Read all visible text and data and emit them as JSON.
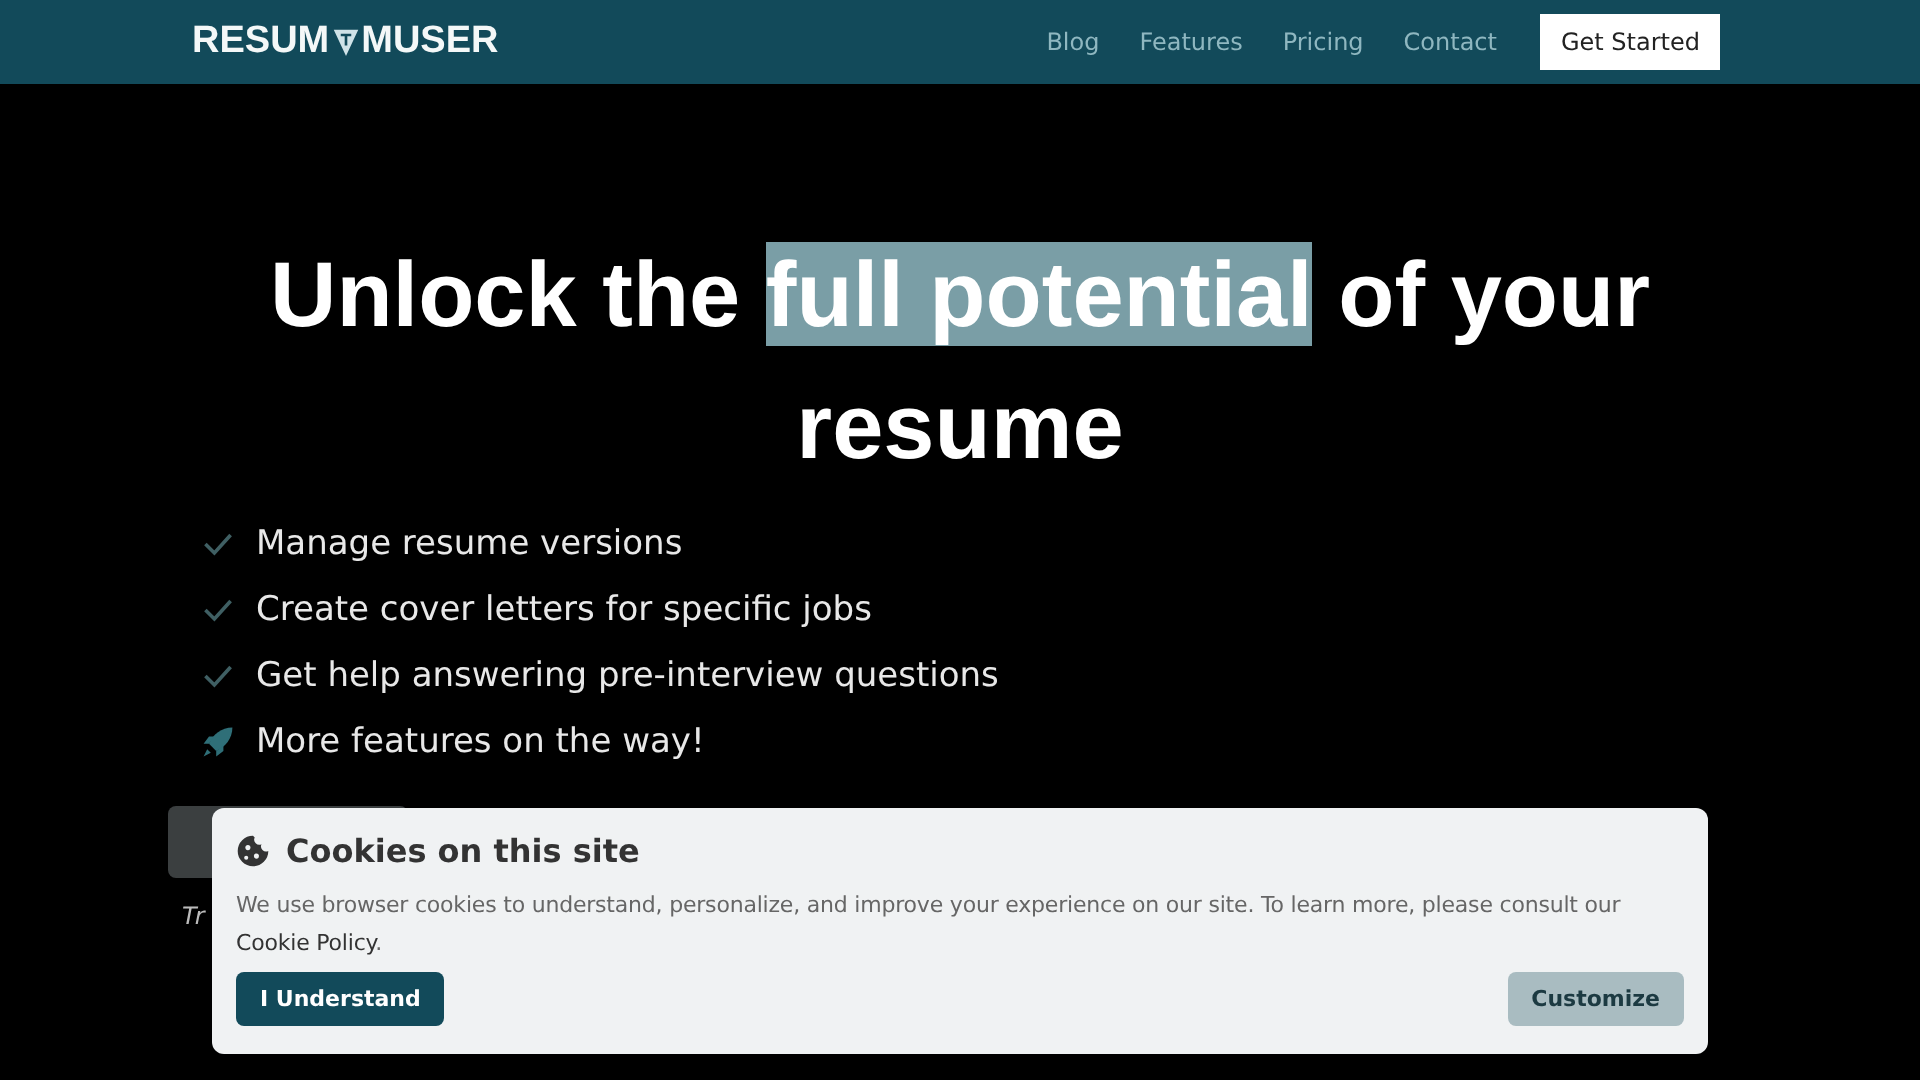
{
  "nav": {
    "logo": {
      "left": "RESUM",
      "right": "MUSER"
    },
    "links": [
      "Blog",
      "Features",
      "Pricing",
      "Contact"
    ],
    "cta": "Get Started"
  },
  "hero": {
    "headline": {
      "before": "Unlock the ",
      "highlight": "full potential",
      "after": " of your resume"
    },
    "features": [
      {
        "kind": "check",
        "text": "Manage resume versions"
      },
      {
        "kind": "check",
        "text": "Create cover letters for specific jobs"
      },
      {
        "kind": "check",
        "text": "Get help answering pre-interview questions"
      },
      {
        "kind": "rocket",
        "text": "More features on the way!"
      }
    ],
    "note": "Tr"
  },
  "cookie_banner": {
    "title": "Cookies on this site",
    "body": "We use browser cookies to understand, personalize, and improve your experience on our site. To learn more, please consult our",
    "link": "Cookie Policy",
    "link_suffix": ".",
    "accept": "I Understand",
    "customize": "Customize"
  }
}
